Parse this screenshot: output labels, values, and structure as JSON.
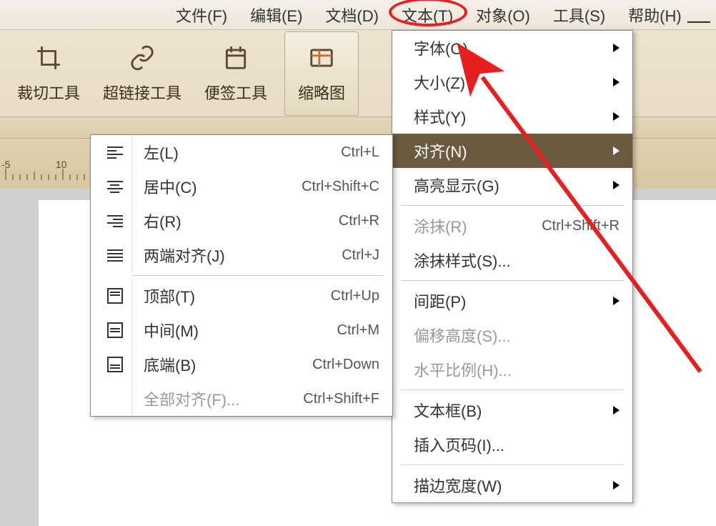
{
  "menubar": {
    "file": "文件(F)",
    "edit": "编辑(E)",
    "document": "文档(D)",
    "text": "文本(T)",
    "object": "对象(O)",
    "tools": "工具(S)",
    "help": "帮助(H)"
  },
  "toolbar": {
    "crop": "裁切工具",
    "hyperlink": "超链接工具",
    "note": "便签工具",
    "thumbnail": "缩略图"
  },
  "ruler": {
    "nums": [
      "-5",
      "10"
    ]
  },
  "text_menu": {
    "font": "字体(O)",
    "size": "大小(Z)",
    "style": "样式(Y)",
    "align": "对齐(N)",
    "highlight": "高亮显示(G)",
    "smear": "涂抹(R)",
    "smear_shortcut": "Ctrl+Shift+R",
    "smear_style": "涂抹样式(S)...",
    "spacing": "间距(P)",
    "offset_height": "偏移高度(S)...",
    "horiz_scale": "水平比例(H)...",
    "textbox": "文本框(B)",
    "insert_pagenum": "插入页码(I)...",
    "stroke_width": "描边宽度(W)"
  },
  "align_menu": {
    "left": "左(L)",
    "left_sc": "Ctrl+L",
    "center": "居中(C)",
    "center_sc": "Ctrl+Shift+C",
    "right": "右(R)",
    "right_sc": "Ctrl+R",
    "justify": "两端对齐(J)",
    "justify_sc": "Ctrl+J",
    "top": "顶部(T)",
    "top_sc": "Ctrl+Up",
    "middle": "中间(M)",
    "middle_sc": "Ctrl+M",
    "bottom": "底端(B)",
    "bottom_sc": "Ctrl+Down",
    "all": "全部对齐(F)...",
    "all_sc": "Ctrl+Shift+F"
  }
}
